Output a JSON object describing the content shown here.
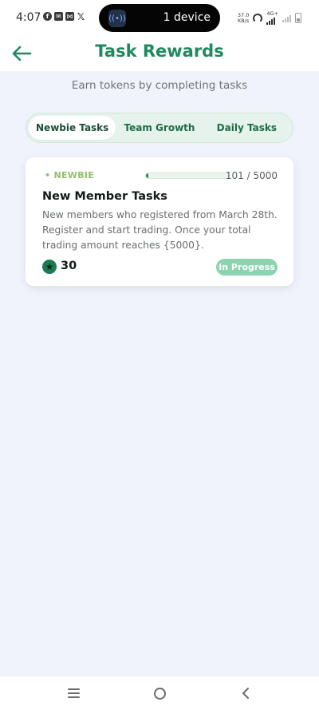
{
  "status_bar": {
    "time": "4:07",
    "notification_icons": [
      "facebook-icon",
      "mail-icon",
      "capcut-icon",
      "x-icon"
    ],
    "island_icon": "broadcast-icon",
    "island_text": "1 device",
    "net_speed_value": "37.0",
    "net_speed_unit": "KB/s",
    "network_type": "4G+",
    "icons": [
      "hotspot-icon",
      "signal-icon",
      "signal-icon",
      "battery-icon"
    ]
  },
  "header": {
    "back_icon": "arrow-left-icon",
    "title": "Task Rewards"
  },
  "subtitle": "Earn tokens by completing tasks",
  "tabs": [
    {
      "label": "Newbie Tasks",
      "active": true
    },
    {
      "label": "Team Growth",
      "active": false
    },
    {
      "label": "Daily Tasks",
      "active": false
    }
  ],
  "task_card": {
    "badge": "• NEWBIE",
    "progress_current": 101,
    "progress_total": 5000,
    "progress_text": "101 / 5000",
    "title": "New Member Tasks",
    "description": "New members who registered from March 28th. Register and start trading. Once your total trading amount reaches {5000}.",
    "reward_icon": "star-coin-icon",
    "reward_value": "30",
    "status": "In Progress"
  },
  "colors": {
    "accent": "#1f8a5d",
    "background": "#f0f3fb",
    "badge_green": "#8fc06d",
    "status_badge": "#8cd3b0"
  },
  "nav_bar": {
    "icons": [
      "menu-icon",
      "home-icon",
      "back-chevron-icon"
    ]
  }
}
